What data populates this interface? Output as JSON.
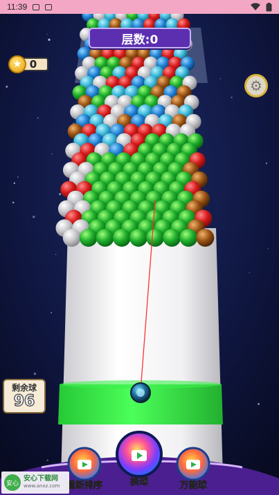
{
  "status_bar": {
    "time": "11:39",
    "left_icons": [
      "notification-a-icon",
      "notification-message-icon"
    ],
    "right_icons": [
      "wifi-icon",
      "battery-icon"
    ]
  },
  "hud": {
    "level_label": "层数:0",
    "coins": "0",
    "remaining_label": "剩余球",
    "remaining_count": "96"
  },
  "buttons": {
    "reshuffle": "重新排序",
    "swap_ball": "换球",
    "wild_ball": "万能球"
  },
  "watermark": {
    "title": "安心下载网",
    "url": "www.anxz.com",
    "logo_text": "安心"
  },
  "colors": {
    "status_bar": "#f3a7c4",
    "tower_white": "#f2f2f2",
    "tower_band": "#3af04a",
    "level_badge": "#5b2fb0",
    "bottom_bar": "#4b1f8f"
  }
}
